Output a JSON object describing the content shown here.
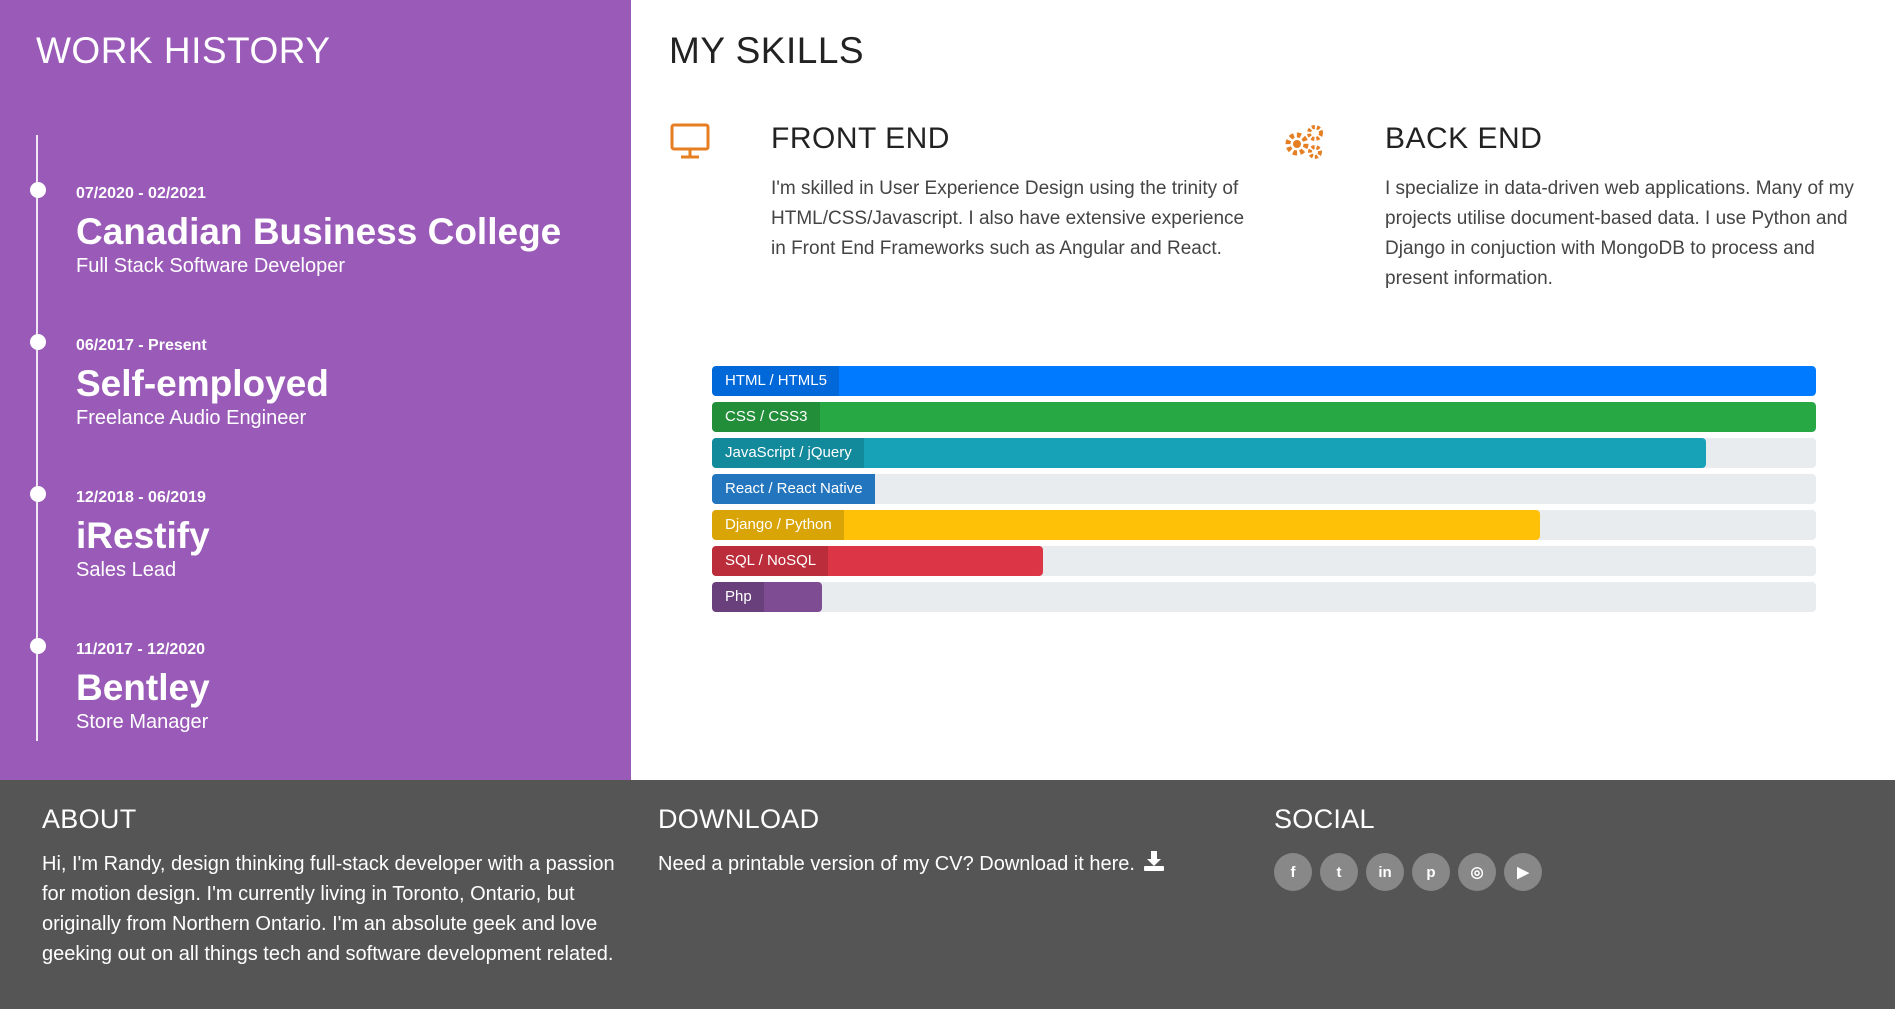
{
  "work_history": {
    "title": "WORK HISTORY",
    "jobs": [
      {
        "dates": "07/2020 - 02/2021",
        "company": "Canadian Business College",
        "role": "Full Stack Software Developer"
      },
      {
        "dates": "06/2017 - Present",
        "company": "Self-employed",
        "role": "Freelance Audio Engineer"
      },
      {
        "dates": "12/2018 - 06/2019",
        "company": "iRestify",
        "role": "Sales Lead"
      },
      {
        "dates": "11/2017 - 12/2020",
        "company": "Bentley",
        "role": "Store Manager"
      }
    ]
  },
  "skills": {
    "title": "MY SKILLS",
    "front_end": {
      "icon": "monitor-icon",
      "heading": "FRONT END",
      "text": "I'm skilled in User Experience Design using the trinity of HTML/CSS/Javascript. I also have extensive experience in Front End Frameworks such as Angular and React."
    },
    "back_end": {
      "icon": "gears-icon",
      "heading": "BACK END",
      "text": "I specialize in data-driven web applications. Many of my projects utilise document-based data. I use Python and Django in conjuction with MongoDB to process and present information."
    },
    "accent_color": "#e67e22",
    "bars": [
      {
        "label": "HTML / HTML5",
        "percent": 100,
        "color": "#007bff"
      },
      {
        "label": "CSS / CSS3",
        "percent": 100,
        "color": "#28a745"
      },
      {
        "label": "JavaScript / jQuery",
        "percent": 90,
        "color": "#17a2b8"
      },
      {
        "label": "React / React Native",
        "percent": 10,
        "color": "#2a8ae0"
      },
      {
        "label": "Django / Python",
        "percent": 75,
        "color": "#ffc107"
      },
      {
        "label": "SQL / NoSQL",
        "percent": 30,
        "color": "#dc3545"
      },
      {
        "label": "Php",
        "percent": 10,
        "color": "#7d4c92"
      }
    ]
  },
  "footer": {
    "about": {
      "title": "ABOUT",
      "text": "Hi, I'm Randy, design thinking full-stack developer with a passion for motion design. I'm currently living in Toronto, Ontario, but originally from Northern Ontario. I'm an absolute geek and love geeking out on all things tech and software development related."
    },
    "download": {
      "title": "DOWNLOAD",
      "text": "Need a printable version of my CV? Download it here.",
      "icon": "download-icon"
    },
    "social": {
      "title": "SOCIAL",
      "icons": [
        "facebook-icon",
        "twitter-icon",
        "linkedin-icon",
        "pinterest-icon",
        "instagram-icon",
        "youtube-icon"
      ]
    }
  }
}
